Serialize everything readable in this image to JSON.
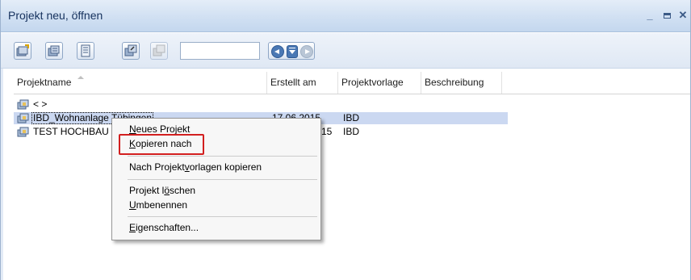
{
  "window": {
    "title": "Projekt neu, öffnen",
    "controls": {
      "minimize": "_",
      "close": "✕"
    }
  },
  "toolbar": {
    "search_value": "",
    "buttons": [
      "new-project-icon",
      "project-settings-icon",
      "properties-icon",
      "copy-icon",
      "paste-icon"
    ]
  },
  "columns": [
    "Projektname",
    "Erstellt am",
    "Projektvorlage",
    "Beschreibung"
  ],
  "rows": [
    {
      "name": "<    >",
      "date": "",
      "template": "",
      "description": ""
    },
    {
      "name": "IBD_Wohnanlage Tübingen",
      "date": "17.06.2015",
      "template": "IBD",
      "description": ""
    },
    {
      "name": "TEST HOCHBAU",
      "date": "…15",
      "template": "IBD",
      "description": ""
    }
  ],
  "context_menu": {
    "items": [
      {
        "pre": "",
        "u": "N",
        "post": "eues Projekt"
      },
      {
        "pre": "",
        "u": "K",
        "post": "opieren nach"
      },
      {
        "pre": "Nach Projekt",
        "u": "v",
        "post": "orlagen kopieren"
      },
      {
        "pre": "Projekt l",
        "u": "ö",
        "post": "schen"
      },
      {
        "pre": "",
        "u": "U",
        "post": "mbenennen"
      },
      {
        "pre": "",
        "u": "E",
        "post": "igenschaften..."
      }
    ]
  },
  "colors": {
    "selection": "#cbd8f1",
    "highlight_border": "#d21f1f",
    "title_text": "#15315d"
  }
}
